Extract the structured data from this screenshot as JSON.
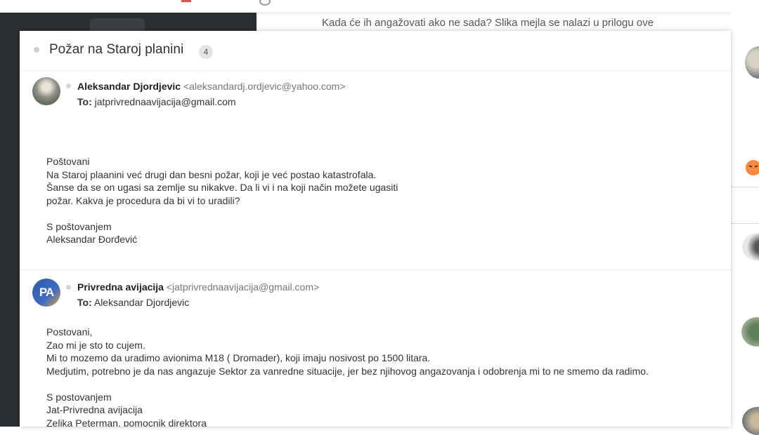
{
  "background": {
    "snippet_text": "Kada će ih angažovati ako ne sada? Slika mejla se nalazi u prilogu ove"
  },
  "thread": {
    "subject": "Požar na Staroj planini",
    "message_count": "4",
    "messages": [
      {
        "sender_name": "Aleksandar Djordjevic",
        "sender_email": "<aleksandardj.ordjevic@yahoo.com>",
        "to_label": "To:",
        "to_value": "jatprivrednaavijacija@gmail.com",
        "body": [
          "Poštovani",
          "Na Staroj plaanini već drugi dan besni požar, koji je već postao katastrofala.",
          "Šanse da se on ugasi sa zemlje su nikakve. Da li vi i na koji način možete ugasiti",
          "požar. Kakva je procedura da bi vi to uradili?",
          "",
          "S poštovanjem",
          "Aleksandar Đorđević"
        ]
      },
      {
        "avatar_initials": "PA",
        "sender_name": "Privredna avijacija",
        "sender_email": "<jatprivrednaavijacija@gmail.com>",
        "to_label": "To:",
        "to_value": "Aleksandar Djordjevic",
        "body": [
          "Postovani,",
          "Zao mi je sto to cujem.",
          "Mi to mozemo da uradimo avionima M18 ( Dromader), koji imaju nosivost po 1500 litara.",
          "Medjutim, potrebno je da nas angazuje Sektor za vanredne situacije, jer bez njihovog angazovanja i odobrenja mi to ne smemo da radimo.",
          "",
          "S postovanjem",
          "Jat-Privredna avijacija",
          "Zeljka Peterman, pomocnik direktora"
        ]
      }
    ]
  }
}
